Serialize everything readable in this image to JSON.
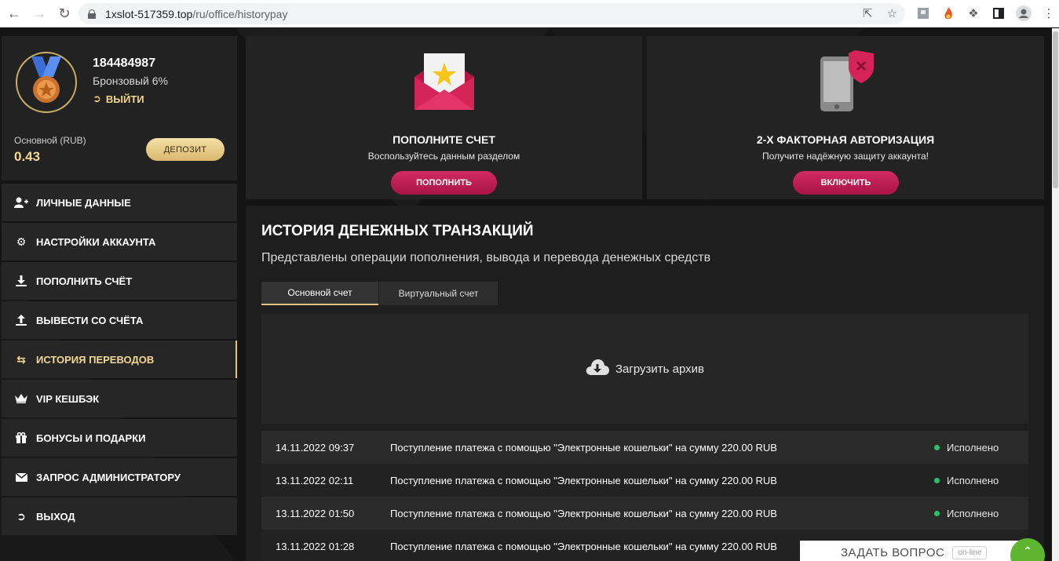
{
  "browser": {
    "url_host": "1xslot-517359.top",
    "url_path": "/ru/office/historypay"
  },
  "profile": {
    "user_id": "184484987",
    "rank": "Бронзовый 6%",
    "logout_label": "ВЫЙТИ",
    "balance_label": "Основной (RUB)",
    "balance_value": "0.43",
    "deposit_label": "ДЕПОЗИТ"
  },
  "menu": {
    "items": [
      {
        "label": "ЛИЧНЫЕ ДАННЫЕ",
        "icon": "user-plus-icon"
      },
      {
        "label": "НАСТРОЙКИ АККАУНТА",
        "icon": "gears-icon"
      },
      {
        "label": "ПОПОЛНИТЬ СЧЁТ",
        "icon": "download-icon"
      },
      {
        "label": "ВЫВЕСТИ СО СЧЁТА",
        "icon": "upload-icon"
      },
      {
        "label": "ИСТОРИЯ ПЕРЕВОДОВ",
        "icon": "transfer-arrows-icon",
        "active": true
      },
      {
        "label": "VIP КЕШБЭК",
        "icon": "crown-icon"
      },
      {
        "label": "БОНУСЫ И ПОДАРКИ",
        "icon": "gift-icon"
      },
      {
        "label": "ЗАПРОС АДМИНИСТРАТОРУ",
        "icon": "envelope-icon"
      },
      {
        "label": "ВЫХОД",
        "icon": "sign-out-icon"
      }
    ]
  },
  "cards": {
    "deposit": {
      "title": "ПОПОЛНИТЕ СЧЕТ",
      "subtitle": "Воспользуйтесь данным разделом",
      "button": "ПОПОЛНИТЬ"
    },
    "twofa": {
      "title": "2-Х ФАКТОРНАЯ АВТОРИЗАЦИЯ",
      "subtitle": "Получите надёжную защиту аккаунта!",
      "button": "ВКЛЮЧИТЬ"
    }
  },
  "history": {
    "title": "ИСТОРИЯ ДЕНЕЖНЫХ ТРАНЗАКЦИЙ",
    "subtitle": "Представлены операции пополнения, вывода и перевода денежных средств",
    "tabs": [
      "Основной счет",
      "Виртуальный счет"
    ],
    "archive_label": "Загрузить архив",
    "rows": [
      {
        "date": "14.11.2022 09:37",
        "desc": "Поступление платежа с помощью \"Электронные кошельки\" на сумму 220.00 RUB",
        "status": "Исполнено"
      },
      {
        "date": "13.11.2022 02:11",
        "desc": "Поступление платежа с помощью \"Электронные кошельки\" на сумму 220.00 RUB",
        "status": "Исполнено"
      },
      {
        "date": "13.11.2022 01:50",
        "desc": "Поступление платежа с помощью \"Электронные кошельки\" на сумму 220.00 RUB",
        "status": "Исполнено"
      },
      {
        "date": "13.11.2022 01:28",
        "desc": "Поступление платежа с помощью \"Электронные кошельки\" на сумму 220.00 RUB",
        "status": ""
      }
    ]
  },
  "chat": {
    "ask_label": "ЗАДАТЬ ВОПРОС",
    "status": "on-line"
  },
  "colors": {
    "accent_gold": "#f2d896",
    "accent_pink": "#c91f58",
    "status_green": "#2dbf6c"
  }
}
